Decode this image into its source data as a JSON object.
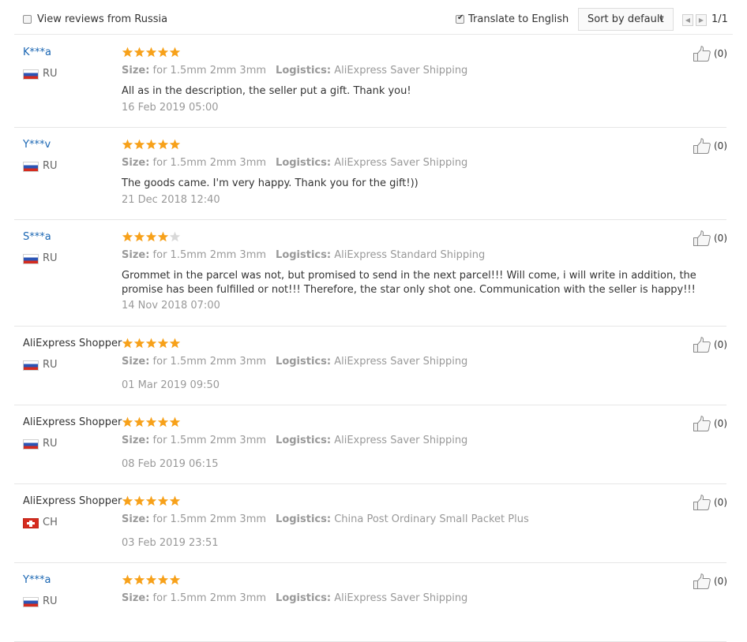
{
  "toolbar": {
    "russia_label": "View reviews from Russia",
    "russia_checked": false,
    "translate_label": "Translate to English",
    "translate_checked": true,
    "sort_label": "Sort by default",
    "page_text": "1/1"
  },
  "colors": {
    "star_on": "#f7a11a",
    "star_off": "#d9d9d9",
    "username_link": "#1a66b3"
  },
  "labels": {
    "size": "Size:",
    "logistics": "Logistics:"
  },
  "reviews": [
    {
      "name": "K***a",
      "masked": true,
      "flag": "ru",
      "country": "RU",
      "rating": 5,
      "size": "for 1.5mm 2mm 3mm",
      "logistics": "AliExpress Saver Shipping",
      "text": "All as in the description, the seller put a gift. Thank you!",
      "date": "16 Feb 2019 05:00",
      "likes": "(0)"
    },
    {
      "name": "Y***v",
      "masked": true,
      "flag": "ru",
      "country": "RU",
      "rating": 5,
      "size": "for 1.5mm 2mm 3mm",
      "logistics": "AliExpress Saver Shipping",
      "text": "The goods came. I'm very happy. Thank you for the gift!))",
      "date": "21 Dec 2018 12:40",
      "likes": "(0)"
    },
    {
      "name": "S***a",
      "masked": true,
      "flag": "ru",
      "country": "RU",
      "rating": 4,
      "size": "for 1.5mm 2mm 3mm",
      "logistics": "AliExpress Standard Shipping",
      "text": "Grommet in the parcel was not, but promised to send in the next parcel!!! Will come, i will write in addition, the promise has been fulfilled or not!!! Therefore, the star only shot one. Communication with the seller is happy!!!",
      "date": "14 Nov 2018 07:00",
      "likes": "(0)"
    },
    {
      "name": "AliExpress Shopper",
      "masked": false,
      "flag": "ru",
      "country": "RU",
      "rating": 5,
      "size": "for 1.5mm 2mm 3mm",
      "logistics": "AliExpress Saver Shipping",
      "text": "",
      "date": "01 Mar 2019 09:50",
      "likes": "(0)"
    },
    {
      "name": "AliExpress Shopper",
      "masked": false,
      "flag": "ru",
      "country": "RU",
      "rating": 5,
      "size": "for 1.5mm 2mm 3mm",
      "logistics": "AliExpress Saver Shipping",
      "text": "",
      "date": "08 Feb 2019 06:15",
      "likes": "(0)"
    },
    {
      "name": "AliExpress Shopper",
      "masked": false,
      "flag": "ch",
      "country": "CH",
      "rating": 5,
      "size": "for 1.5mm 2mm 3mm",
      "logistics": "China Post Ordinary Small Packet Plus",
      "text": "",
      "date": "03 Feb 2019 23:51",
      "likes": "(0)"
    },
    {
      "name": "Y***a",
      "masked": true,
      "flag": "ru",
      "country": "RU",
      "rating": 5,
      "size": "for 1.5mm 2mm 3mm",
      "logistics": "AliExpress Saver Shipping",
      "text": "",
      "date": "",
      "likes": "(0)"
    }
  ]
}
